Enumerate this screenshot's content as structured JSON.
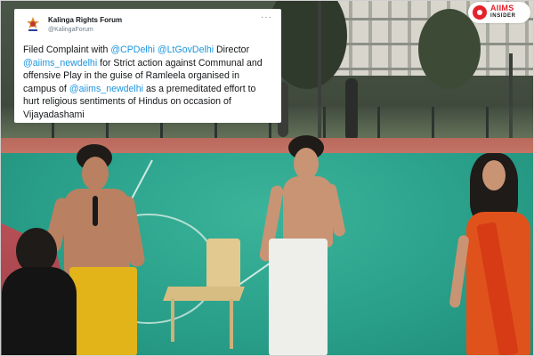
{
  "tweet": {
    "account_name": "Kalinga Rights Forum",
    "account_handle": "@KalingaForum",
    "more_icon": "ellipsis-icon",
    "text_parts": [
      {
        "text": "Filed Complaint with ",
        "kind": "plain"
      },
      {
        "text": "@CPDelhi",
        "kind": "mention"
      },
      {
        "text": "  ",
        "kind": "plain"
      },
      {
        "text": "@LtGovDelhi",
        "kind": "mention"
      },
      {
        "text": " Director ",
        "kind": "plain"
      },
      {
        "text": "@aiims_newdelhi",
        "kind": "mention"
      },
      {
        "text": " for Strict action against Communal and offensive Play in the guise of Ramleela organised in campus of ",
        "kind": "plain"
      },
      {
        "text": "@aiims_newdelhi",
        "kind": "mention"
      },
      {
        "text": " as a premeditated effort to hurt religious sentiments of Hindus on occasion of Vijayadashami",
        "kind": "plain"
      }
    ],
    "mention_color": "#1b95e0"
  },
  "badge": {
    "line1": "AIIMS",
    "line2": "INSIDER",
    "brand_color": "#e4222b"
  },
  "scene": {
    "court_color": "#2aa08a",
    "track_color": "#c97666"
  }
}
